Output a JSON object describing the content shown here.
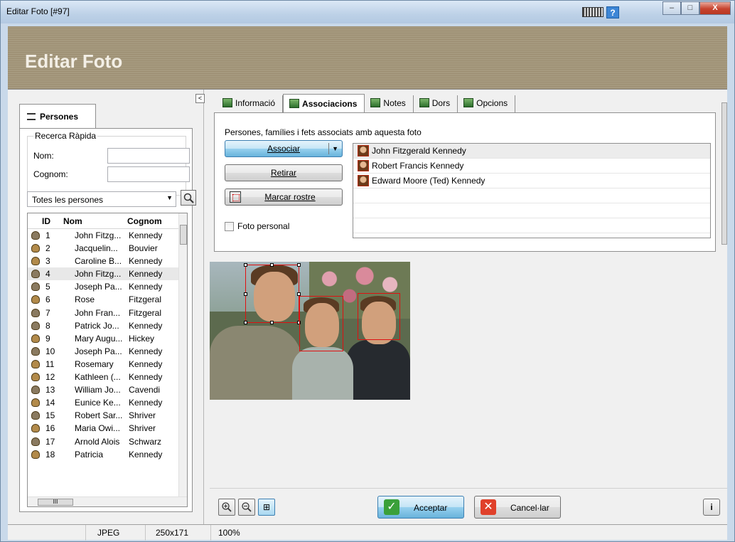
{
  "window": {
    "title": "Editar Foto [#97]",
    "header": "Editar Foto"
  },
  "window_buttons": {
    "minimize": "–",
    "maximize": "□",
    "close": "X",
    "help": "?"
  },
  "left_panel": {
    "collapse_label": "<",
    "tab_label": "Persones",
    "search_group": "Recerca Ràpida",
    "nom_label": "Nom:",
    "cognom_label": "Cognom:",
    "filter_value": "Totes les persones",
    "columns": [
      "ID",
      "Nom",
      "Cognom"
    ],
    "rows": [
      {
        "id": "1",
        "nom": "John Fitzg...",
        "cognom": "Kennedy"
      },
      {
        "id": "2",
        "nom": "Jacquelin...",
        "cognom": "Bouvier"
      },
      {
        "id": "3",
        "nom": "Caroline B...",
        "cognom": "Kennedy"
      },
      {
        "id": "4",
        "nom": "John Fitzg...",
        "cognom": "Kennedy"
      },
      {
        "id": "5",
        "nom": "Joseph Pa...",
        "cognom": "Kennedy"
      },
      {
        "id": "6",
        "nom": "Rose",
        "cognom": "Fitzgeral"
      },
      {
        "id": "7",
        "nom": "John Fran...",
        "cognom": "Fitzgeral"
      },
      {
        "id": "8",
        "nom": "Patrick Jo...",
        "cognom": "Kennedy"
      },
      {
        "id": "9",
        "nom": "Mary Augu...",
        "cognom": "Hickey"
      },
      {
        "id": "10",
        "nom": "Joseph Pa...",
        "cognom": "Kennedy"
      },
      {
        "id": "11",
        "nom": "Rosemary",
        "cognom": "Kennedy"
      },
      {
        "id": "12",
        "nom": "Kathleen (...",
        "cognom": "Kennedy"
      },
      {
        "id": "13",
        "nom": "William Jo...",
        "cognom": "Cavendi"
      },
      {
        "id": "14",
        "nom": "Eunice Ke...",
        "cognom": "Kennedy"
      },
      {
        "id": "15",
        "nom": "Robert Sar...",
        "cognom": "Shriver"
      },
      {
        "id": "16",
        "nom": "Maria Owi...",
        "cognom": "Shriver"
      },
      {
        "id": "17",
        "nom": "Arnold Alois",
        "cognom": "Schwarz"
      },
      {
        "id": "18",
        "nom": "Patricia",
        "cognom": "Kennedy"
      }
    ],
    "hscroll_label": "III"
  },
  "tabs": [
    {
      "label": "Informació"
    },
    {
      "label": "Associacions"
    },
    {
      "label": "Notes"
    },
    {
      "label": "Dors"
    },
    {
      "label": "Opcions"
    }
  ],
  "associations": {
    "description": "Persones, famílies i fets associats amb aquesta foto",
    "associar_label": "Associar",
    "retirar_label": "Retirar",
    "marcar_label": "Marcar rostre",
    "foto_personal_label": "Foto personal",
    "people": [
      "John Fitzgerald Kennedy",
      "Robert Francis Kennedy",
      "Edward Moore (Ted) Kennedy"
    ]
  },
  "bottom": {
    "zoom_in": "+",
    "zoom_out": "–",
    "zoom_fit": "⊞",
    "accept_label": "Acceptar",
    "cancel_label": "Cancel·lar",
    "info_label": "i"
  },
  "status": {
    "format": "JPEG",
    "dimensions": "250x171",
    "zoom": "100%"
  },
  "colors": {
    "header_band": "#a19478",
    "face_box": "#e01010",
    "accept_icon": "#3aa03a",
    "cancel_icon": "#e0402a"
  }
}
